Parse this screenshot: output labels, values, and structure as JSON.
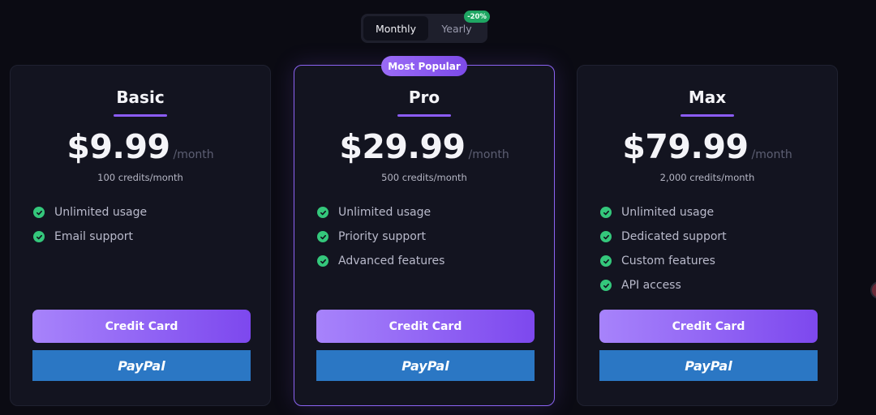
{
  "billing_toggle": {
    "monthly_label": "Monthly",
    "yearly_label": "Yearly",
    "yearly_discount": "-20%"
  },
  "popular_badge": "Most Popular",
  "plans": [
    {
      "name": "Basic",
      "price": "$9.99",
      "per": "/month",
      "credits": "100 credits/month",
      "features": [
        "Unlimited usage",
        "Email support"
      ],
      "credit_card_label": "Credit Card",
      "paypal_label": "PayPal"
    },
    {
      "name": "Pro",
      "price": "$29.99",
      "per": "/month",
      "credits": "500 credits/month",
      "features": [
        "Unlimited usage",
        "Priority support",
        "Advanced features"
      ],
      "credit_card_label": "Credit Card",
      "paypal_label": "PayPal"
    },
    {
      "name": "Max",
      "price": "$79.99",
      "per": "/month",
      "credits": "2,000 credits/month",
      "features": [
        "Unlimited usage",
        "Dedicated support",
        "Custom features",
        "API access"
      ],
      "credit_card_label": "Credit Card",
      "paypal_label": "PayPal"
    }
  ],
  "colors": {
    "accent": "#8b5cf6",
    "check": "#34c77b",
    "paypal": "#2b77c4",
    "background": "#0b0b13"
  }
}
